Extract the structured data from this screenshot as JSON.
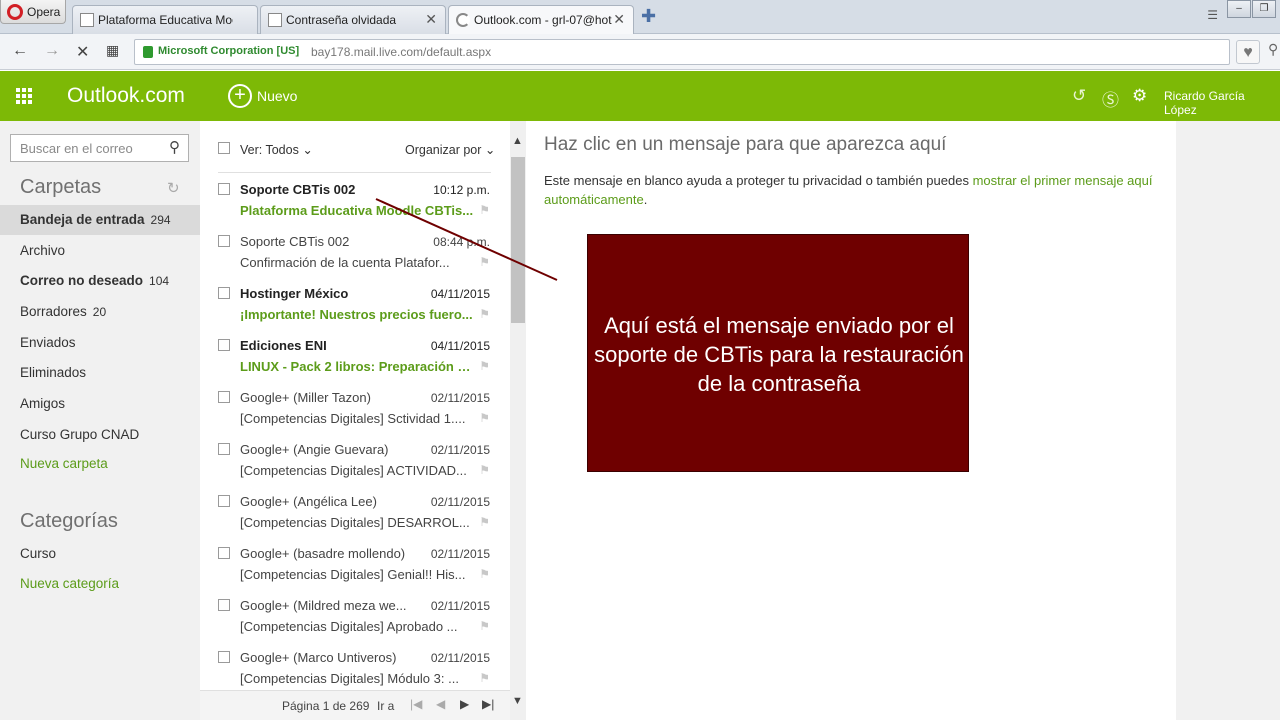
{
  "browser": {
    "menu_label": "Opera",
    "tabs": [
      {
        "label": "Plataforma Educativa Moo"
      },
      {
        "label": "Contraseña olvidada"
      },
      {
        "label": "Outlook.com - grl-07@hot"
      }
    ],
    "org": "Microsoft Corporation [US]",
    "url": "bay178.mail.live.com/default.aspx"
  },
  "header": {
    "brand": "Outlook.com",
    "new_label": "Nuevo",
    "user": "Ricardo García López"
  },
  "sidebar": {
    "search_placeholder": "Buscar en el correo",
    "folders_title": "Carpetas",
    "folders": [
      {
        "label": "Bandeja de entrada",
        "count": "294"
      },
      {
        "label": "Archivo",
        "count": ""
      },
      {
        "label": "Correo no deseado",
        "count": "104"
      },
      {
        "label": "Borradores",
        "count": "20"
      },
      {
        "label": "Enviados",
        "count": ""
      },
      {
        "label": "Eliminados",
        "count": ""
      },
      {
        "label": "Amigos",
        "count": ""
      },
      {
        "label": "Curso Grupo CNAD",
        "count": ""
      }
    ],
    "new_folder": "Nueva carpeta",
    "categories_title": "Categorías",
    "categories": [
      {
        "label": "Curso"
      }
    ],
    "new_category": "Nueva categoría"
  },
  "list": {
    "view_label": "Ver: Todos",
    "sort_label": "Organizar por",
    "messages": [
      {
        "sender": "Soporte CBTis 002",
        "date": "10:12 p.m.",
        "subject": "Plataforma Educativa Moodle CBTis..."
      },
      {
        "sender": "Soporte CBTis 002",
        "date": "08:44 p.m.",
        "subject": "Confirmación de la cuenta Platafor..."
      },
      {
        "sender": "Hostinger México",
        "date": "04/11/2015",
        "subject": "¡Importante! Nuestros precios fuero..."
      },
      {
        "sender": "Ediciones ENI",
        "date": "04/11/2015",
        "subject": "LINUX - Pack 2 libros: Preparación p..."
      },
      {
        "sender": "Google+ (Miller Tazon)",
        "date": "02/11/2015",
        "subject": "[Competencias Digitales] Sctividad 1...."
      },
      {
        "sender": "Google+ (Angie Guevara)",
        "date": "02/11/2015",
        "subject": "[Competencias Digitales] ACTIVIDAD..."
      },
      {
        "sender": "Google+ (Angélica Lee)",
        "date": "02/11/2015",
        "subject": "[Competencias Digitales] DESARROL..."
      },
      {
        "sender": "Google+ (basadre mollendo)",
        "date": "02/11/2015",
        "subject": "[Competencias Digitales] Genial!! His..."
      },
      {
        "sender": "Google+ (Mildred meza we...",
        "date": "02/11/2015",
        "subject": "[Competencias Digitales] Aprobado ..."
      },
      {
        "sender": "Google+ (Marco Untiveros)",
        "date": "02/11/2015",
        "subject": "[Competencias Digitales] Módulo 3: ..."
      }
    ],
    "pager_text": "Página 1 de 269",
    "goto_label": "Ir a"
  },
  "reading": {
    "title": "Haz clic en un mensaje para que aparezca aquí",
    "body_text": "Este mensaje en blanco ayuda a proteger tu privacidad o también puedes",
    "body_link": "mostrar el primer mensaje aquí automáticamente",
    "body_end": "."
  },
  "annotation": {
    "text": "Aquí está el mensaje enviado por el soporte de CBTis para la restauración de la contraseña"
  },
  "colors": {
    "brand_green": "#7db906",
    "link_green": "#5c9c1a",
    "callout": "#6f0000"
  }
}
